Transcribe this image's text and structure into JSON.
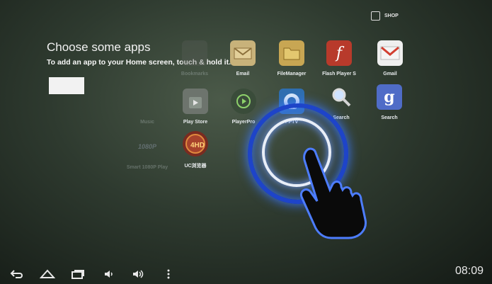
{
  "shop_label": "SHOP",
  "intro": {
    "title": "Choose some apps",
    "subtitle": "To add an app to your Home screen, touch & hold it."
  },
  "apps": [
    {
      "label": "Bookmarks",
      "icon": "bookmarks-icon",
      "dim": true
    },
    {
      "label": "Email",
      "icon": "email-icon",
      "dim": false
    },
    {
      "label": "FileManager",
      "icon": "file-manager-icon",
      "dim": false
    },
    {
      "label": "Flash Player S",
      "icon": "flash-player-icon",
      "dim": false
    },
    {
      "label": "Gmail",
      "icon": "gmail-icon",
      "dim": false
    },
    {
      "label": "Music",
      "icon": "music-icon",
      "dim": true
    },
    {
      "label": "Play Store",
      "icon": "play-store-icon",
      "dim": false
    },
    {
      "label": "PlayerPro",
      "icon": "playerpro-icon",
      "dim": false
    },
    {
      "label": "PPTV",
      "icon": "pptv-icon",
      "dim": false
    },
    {
      "label": "Search",
      "icon": "search-icon",
      "dim": false
    },
    {
      "label": "Search",
      "icon": "google-search-icon",
      "dim": false
    },
    {
      "label": "Smart 1080P Play",
      "icon": "1080p-player-icon",
      "dim": true
    },
    {
      "label": "UC浏览器",
      "icon": "uc-browser-icon",
      "dim": false
    }
  ],
  "navbar": {
    "icons": [
      "back-icon",
      "home-icon",
      "recent-apps-icon",
      "volume-down-icon",
      "volume-up-icon",
      "menu-icon"
    ],
    "clock": "08:09"
  }
}
